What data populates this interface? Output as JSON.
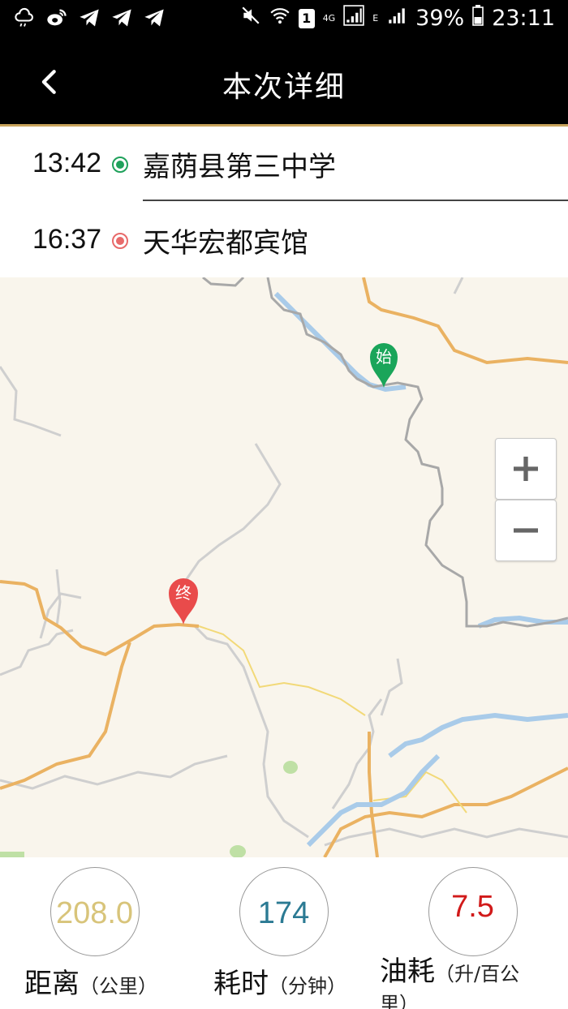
{
  "status_bar": {
    "left_icons": [
      "weather-icon",
      "weibo-icon",
      "telegram-icon",
      "telegram-icon",
      "telegram-icon"
    ],
    "right": {
      "network_type_1": "4G",
      "sim_label": "1",
      "network_type_2": "E",
      "battery": "39%",
      "time": "23:11"
    }
  },
  "header": {
    "title": "本次详细"
  },
  "trip": {
    "start": {
      "time": "13:42",
      "place": "嘉荫县第三中学",
      "color": "#1fa15b"
    },
    "end": {
      "time": "16:37",
      "place": "天华宏都宾馆",
      "color": "#e86a6a"
    }
  },
  "map": {
    "start_marker_label": "始",
    "end_marker_label": "终",
    "start_marker_color": "#1aa55a",
    "end_marker_color": "#e94b4b",
    "zoom_in": "+",
    "zoom_out": "−"
  },
  "stats": {
    "distance": {
      "value": "208.0",
      "label": "距离",
      "unit": "（公里）",
      "color": "#d8c47a"
    },
    "duration": {
      "value": "174",
      "label": "耗时",
      "unit": "（分钟）",
      "color": "#2b7a93"
    },
    "fuel": {
      "value": "7.5",
      "label": "油耗",
      "unit": "（升/百公里）",
      "color": "#d11a1a"
    }
  }
}
